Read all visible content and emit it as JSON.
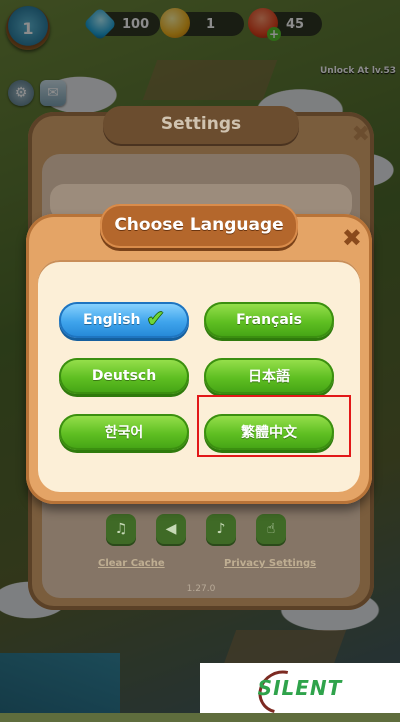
{
  "hud": {
    "level": "1",
    "gems": "100",
    "coins": "1",
    "energy": "45",
    "unlock_text": "Unlock At lv.53"
  },
  "settings": {
    "title": "Settings",
    "clear_cache": "Clear Cache",
    "privacy": "Privacy Settings",
    "version": "1.27.0"
  },
  "language_dialog": {
    "title": "Choose Language",
    "selected": "English",
    "languages": [
      {
        "label": "English",
        "selected": true,
        "color": "#3fa4ec"
      },
      {
        "label": "Français",
        "selected": false,
        "color": "#5fbf22"
      },
      {
        "label": "Deutsch",
        "selected": false,
        "color": "#5fbf22"
      },
      {
        "label": "日本語",
        "selected": false,
        "color": "#5fbf22"
      },
      {
        "label": "한국어",
        "selected": false,
        "color": "#5fbf22"
      },
      {
        "label": "繁體中文",
        "selected": false,
        "color": "#5fbf22"
      }
    ]
  },
  "watermark": {
    "text": "SILENT"
  }
}
